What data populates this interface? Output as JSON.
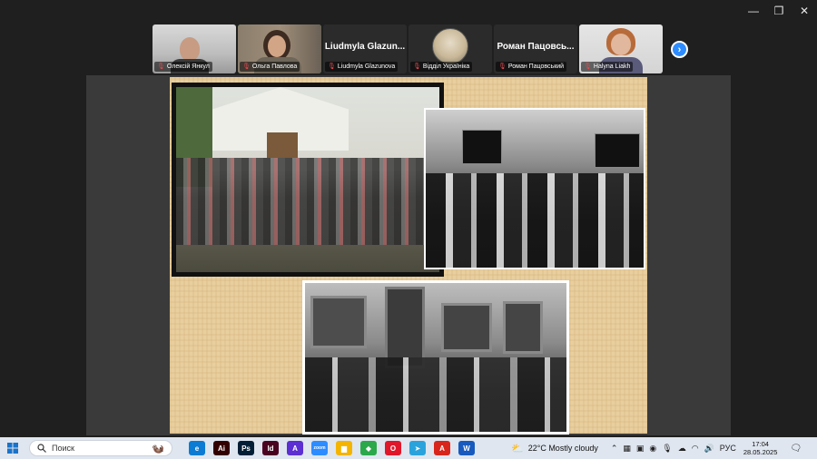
{
  "window_controls": {
    "minimize": "—",
    "restore": "❐",
    "close": "✕"
  },
  "participants": [
    {
      "name": "Олексій Янкул",
      "muted": true
    },
    {
      "name": "Ольга Павлова",
      "muted": true,
      "active": true
    },
    {
      "name": "Liudmyla Glazunova",
      "muted": true,
      "header": "Liudmyla Glazun..."
    },
    {
      "name": "Відділ Україніка",
      "muted": true
    },
    {
      "name": "Роман Пацовський",
      "muted": true,
      "header": "Роман Пацовсь..."
    },
    {
      "name": "Halyna Liakh",
      "muted": true
    }
  ],
  "next_label": "›",
  "taskbar": {
    "search_placeholder": "Поиск",
    "apps": [
      {
        "icon": "edge-icon",
        "glyph": "e",
        "color": "#0c7bd3"
      },
      {
        "icon": "illustrator-icon",
        "glyph": "Ai",
        "color": "#330000"
      },
      {
        "icon": "photoshop-icon",
        "glyph": "Ps",
        "color": "#001e36"
      },
      {
        "icon": "indesign-icon",
        "glyph": "Id",
        "color": "#49021f"
      },
      {
        "icon": "arc-icon",
        "glyph": "A",
        "color": "#5b2fd1"
      },
      {
        "icon": "zoom-icon",
        "glyph": "zoom",
        "color": "#2d8cff"
      },
      {
        "icon": "explorer-icon",
        "glyph": "▆",
        "color": "#f4b400"
      },
      {
        "icon": "notes-icon",
        "glyph": "◆",
        "color": "#2ba84a"
      },
      {
        "icon": "opera-icon",
        "glyph": "O",
        "color": "#e0172a"
      },
      {
        "icon": "telegram-icon",
        "glyph": "➤",
        "color": "#2aa3dd"
      },
      {
        "icon": "acrobat-icon",
        "glyph": "A",
        "color": "#d8261c"
      },
      {
        "icon": "word-icon",
        "glyph": "W",
        "color": "#185abd"
      }
    ],
    "weather": "22°C  Mostly cloudy",
    "language": "РУС",
    "time": "17:04",
    "date": "28.05.2025"
  }
}
